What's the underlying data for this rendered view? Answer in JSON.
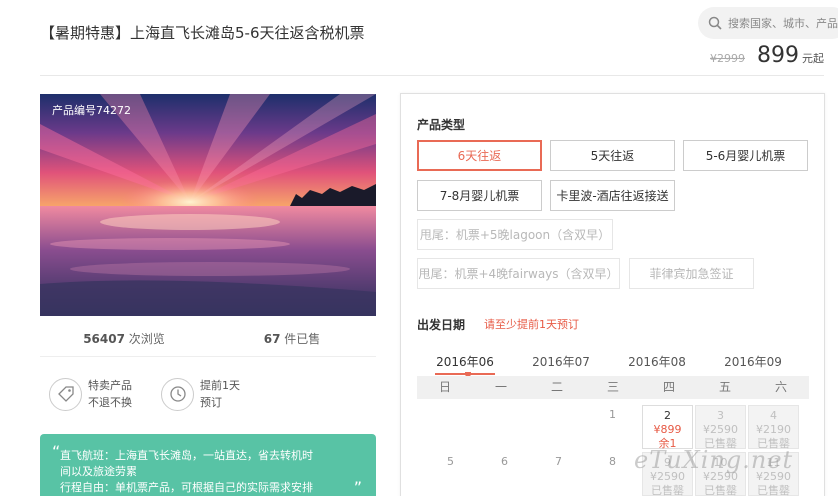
{
  "header": {
    "title": "【暑期特惠】上海直飞长滩岛5-6天往返含税机票",
    "search_placeholder": "搜索国家、城市、产品",
    "old_price": "¥2999",
    "price": "899",
    "price_unit": "元起"
  },
  "gallery": {
    "code": "产品编号74272"
  },
  "stats": {
    "views_count": "56407",
    "views_label": " 次浏览",
    "sold_count": "67",
    "sold_label": " 件已售"
  },
  "features": [
    {
      "line1": "特卖产品",
      "line2": "不退不换",
      "icon": "tag-icon"
    },
    {
      "line1": "提前1天",
      "line2": "预订",
      "icon": "clock-icon"
    }
  ],
  "highlights": {
    "line1": "直飞航班：上海直飞长滩岛，一站直达，省去转机时",
    "line2": "间以及旅途劳累",
    "line3": "行程自由：单机票产品，可根据自己的实际需求安排"
  },
  "product_type": {
    "label": "产品类型",
    "options": [
      "6天往返",
      "5天往返",
      "5-6月婴儿机票",
      "7-8月婴儿机票",
      "卡里波-酒店往返接送"
    ],
    "disabled_options": [
      "甩尾：机票+5晚lagoon（含双早）",
      "甩尾：机票+4晚fairways（含双早）",
      "菲律宾加急签证"
    ]
  },
  "departure": {
    "label": "出发日期",
    "note": "请至少提前1天预订",
    "months": [
      "2016年06",
      "2016年07",
      "2016年08",
      "2016年09"
    ],
    "weekdays": [
      "日",
      "一",
      "二",
      "三",
      "四",
      "五",
      "六"
    ],
    "row1_plain": [
      "1"
    ],
    "row2_plain": [
      "5",
      "6",
      "7",
      "8"
    ],
    "cells": [
      {
        "day": "2",
        "price": "¥899",
        "status": "余1"
      },
      {
        "day": "3",
        "price": "¥2590",
        "status": "已售罄"
      },
      {
        "day": "4",
        "price": "¥2190",
        "status": "已售罄"
      },
      {
        "day": "9",
        "price": "¥2590",
        "status": "已售罄"
      },
      {
        "day": "10",
        "price": "¥2590",
        "status": "已售罄"
      },
      {
        "day": "11",
        "price": "¥2590",
        "status": "已售罄"
      }
    ]
  },
  "watermark": "eTuXing.net",
  "colors": {
    "accent": "#e96a55",
    "green": "#58c3a5"
  }
}
